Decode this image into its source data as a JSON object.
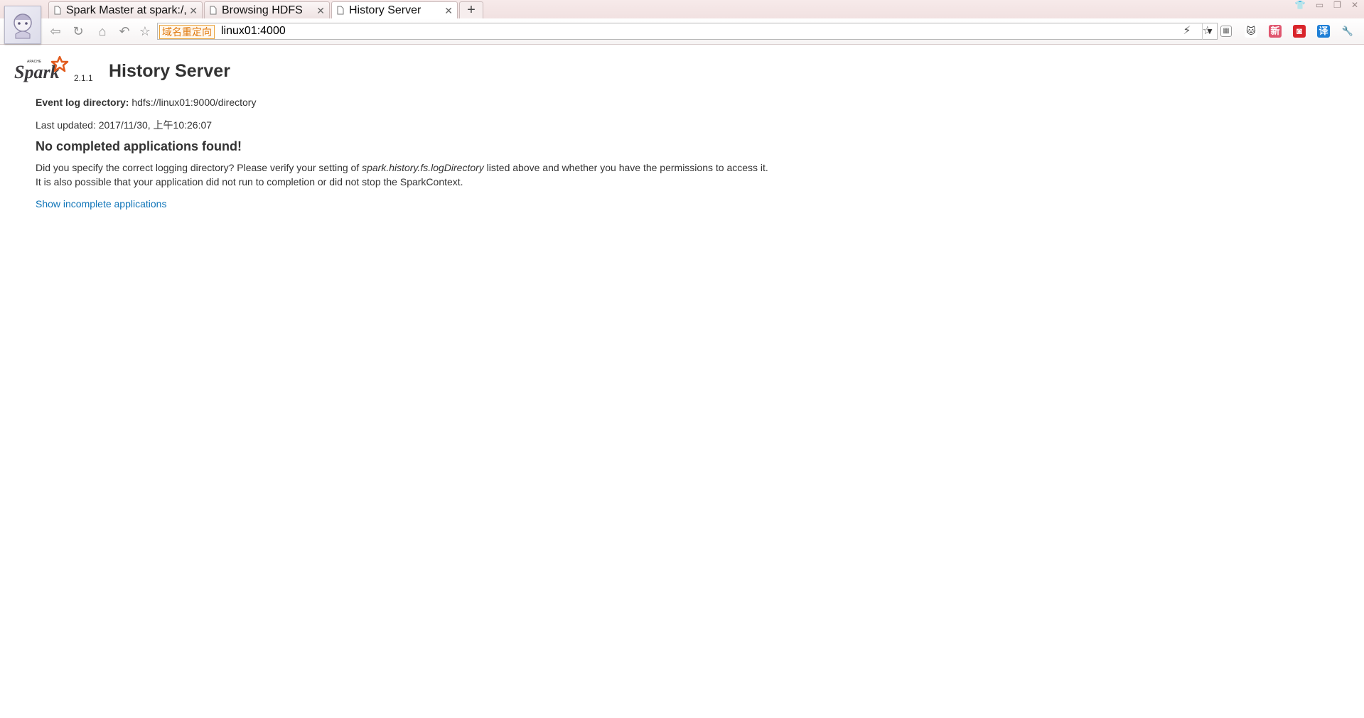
{
  "browser": {
    "tabs": [
      {
        "title": "Spark Master at spark:/,",
        "active": false
      },
      {
        "title": "Browsing HDFS",
        "active": false
      },
      {
        "title": "History Server",
        "active": true
      }
    ],
    "new_tab_label": "+",
    "redirect_badge": "域名重定向",
    "url": "linux01:4000",
    "extensions": [
      {
        "icon": "tiles-icon",
        "label": "",
        "color": "#666666"
      },
      {
        "icon": "cat-icon",
        "label": "",
        "color": "#333333"
      },
      {
        "icon": "news-icon",
        "label": "新",
        "color": "#e0566f"
      },
      {
        "icon": "red-app-icon",
        "label": "",
        "color": "#d9252b"
      },
      {
        "icon": "translate-icon",
        "label": "译",
        "color": "#1f7fd6"
      },
      {
        "icon": "wrench-icon",
        "label": "",
        "color": "#777777"
      }
    ]
  },
  "header": {
    "logo_text": "Spark",
    "logo_small": "APACHE",
    "version": "2.1.1",
    "title": "History Server"
  },
  "main": {
    "event_log_label": "Event log directory:",
    "event_log_value": "hdfs://linux01:9000/directory",
    "last_updated": "Last updated: 2017/11/30, 上午10:26:07",
    "no_apps_heading": "No completed applications found!",
    "help_line1_pre": "Did you specify the correct logging directory? Please verify your setting of ",
    "help_line1_em": "spark.history.fs.logDirectory",
    "help_line1_post": " listed above and whether you have the permissions to access it.",
    "help_line2": "It is also possible that your application did not run to completion or did not stop the SparkContext.",
    "show_incomplete_link": "Show incomplete applications"
  },
  "colors": {
    "link": "#0f74b8",
    "spark_orange": "#e25a1c"
  }
}
